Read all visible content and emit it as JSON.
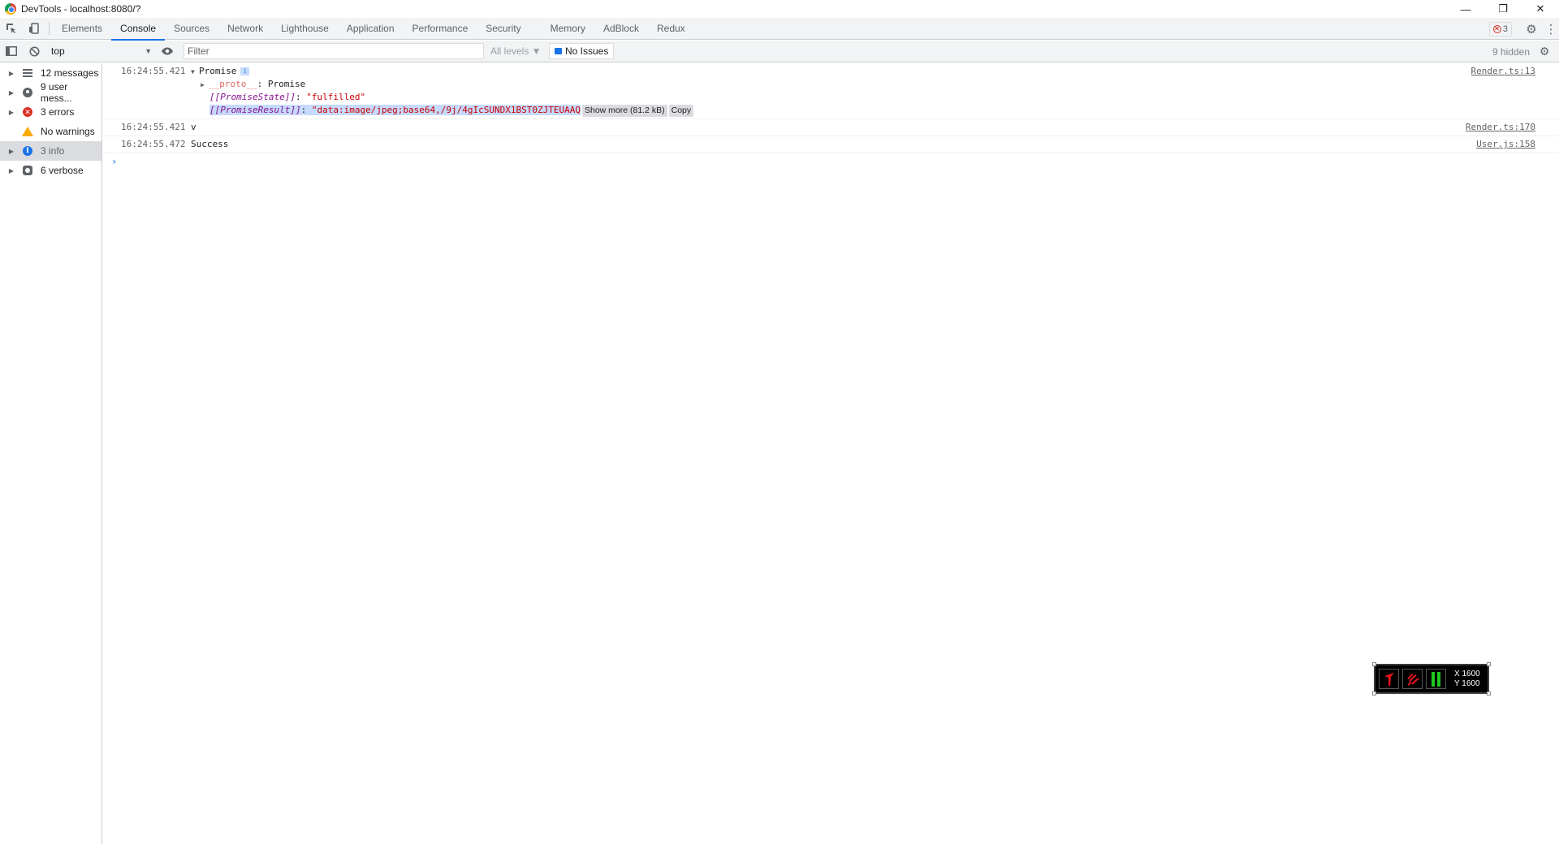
{
  "window": {
    "title": "DevTools - localhost:8080/?",
    "controls": {
      "minimize": "—",
      "restore": "❐",
      "close": "✕"
    }
  },
  "tabs": [
    {
      "label": "Elements",
      "active": false
    },
    {
      "label": "Console",
      "active": true
    },
    {
      "label": "Sources",
      "active": false
    },
    {
      "label": "Network",
      "active": false
    },
    {
      "label": "Lighthouse",
      "active": false
    },
    {
      "label": "Application",
      "active": false
    },
    {
      "label": "Performance",
      "active": false
    },
    {
      "label": "Security",
      "active": false
    },
    {
      "label": "Memory",
      "active": false
    },
    {
      "label": "AdBlock",
      "active": false
    },
    {
      "label": "Redux",
      "active": false
    }
  ],
  "error_badge": {
    "count": "3"
  },
  "toolbar": {
    "context": "top",
    "filter_placeholder": "Filter",
    "levels": "All levels ▼",
    "issues": "No Issues",
    "hidden": "9 hidden"
  },
  "sidebar": {
    "items": [
      {
        "label": "12 messages",
        "icon": "list-icon",
        "expandable": true,
        "selected": false
      },
      {
        "label": "9 user mess...",
        "icon": "user-icon",
        "expandable": true,
        "selected": false
      },
      {
        "label": "3 errors",
        "icon": "error-icon",
        "expandable": true,
        "selected": false
      },
      {
        "label": "No warnings",
        "icon": "warning-icon",
        "expandable": false,
        "selected": false
      },
      {
        "label": "3 info",
        "icon": "info-icon",
        "expandable": true,
        "selected": true
      },
      {
        "label": "6 verbose",
        "icon": "verbose-icon",
        "expandable": true,
        "selected": false
      }
    ]
  },
  "console": {
    "entry1": {
      "timestamp": "16:24:55.421",
      "summary": "Promise",
      "source": "Render.ts:13",
      "proto_key": "__proto__",
      "proto_value": ": Promise",
      "state_key": "[[PromiseState]]",
      "state_value": "\"fulfilled\"",
      "result_key": "[[PromiseResult]]",
      "result_value": "\"data:image/jpeg;base64,/9j/4gIcSUNDX1BST0ZJTEUAAQ",
      "show_more": "Show more (81.2 kB)",
      "copy": "Copy"
    },
    "entry2": {
      "timestamp": "16:24:55.421",
      "message": "v",
      "source": "Render.ts:170"
    },
    "entry3": {
      "timestamp": "16:24:55.472",
      "message": "Success",
      "source": "User.js:158"
    },
    "prompt": "›"
  },
  "overlay": {
    "x_label": "X 1600",
    "y_label": "Y 1600"
  },
  "colors": {
    "accent": "#1a73e8",
    "error": "#d93025",
    "warning": "#f9ab00",
    "string": "#c80000",
    "internal": "#881391"
  }
}
